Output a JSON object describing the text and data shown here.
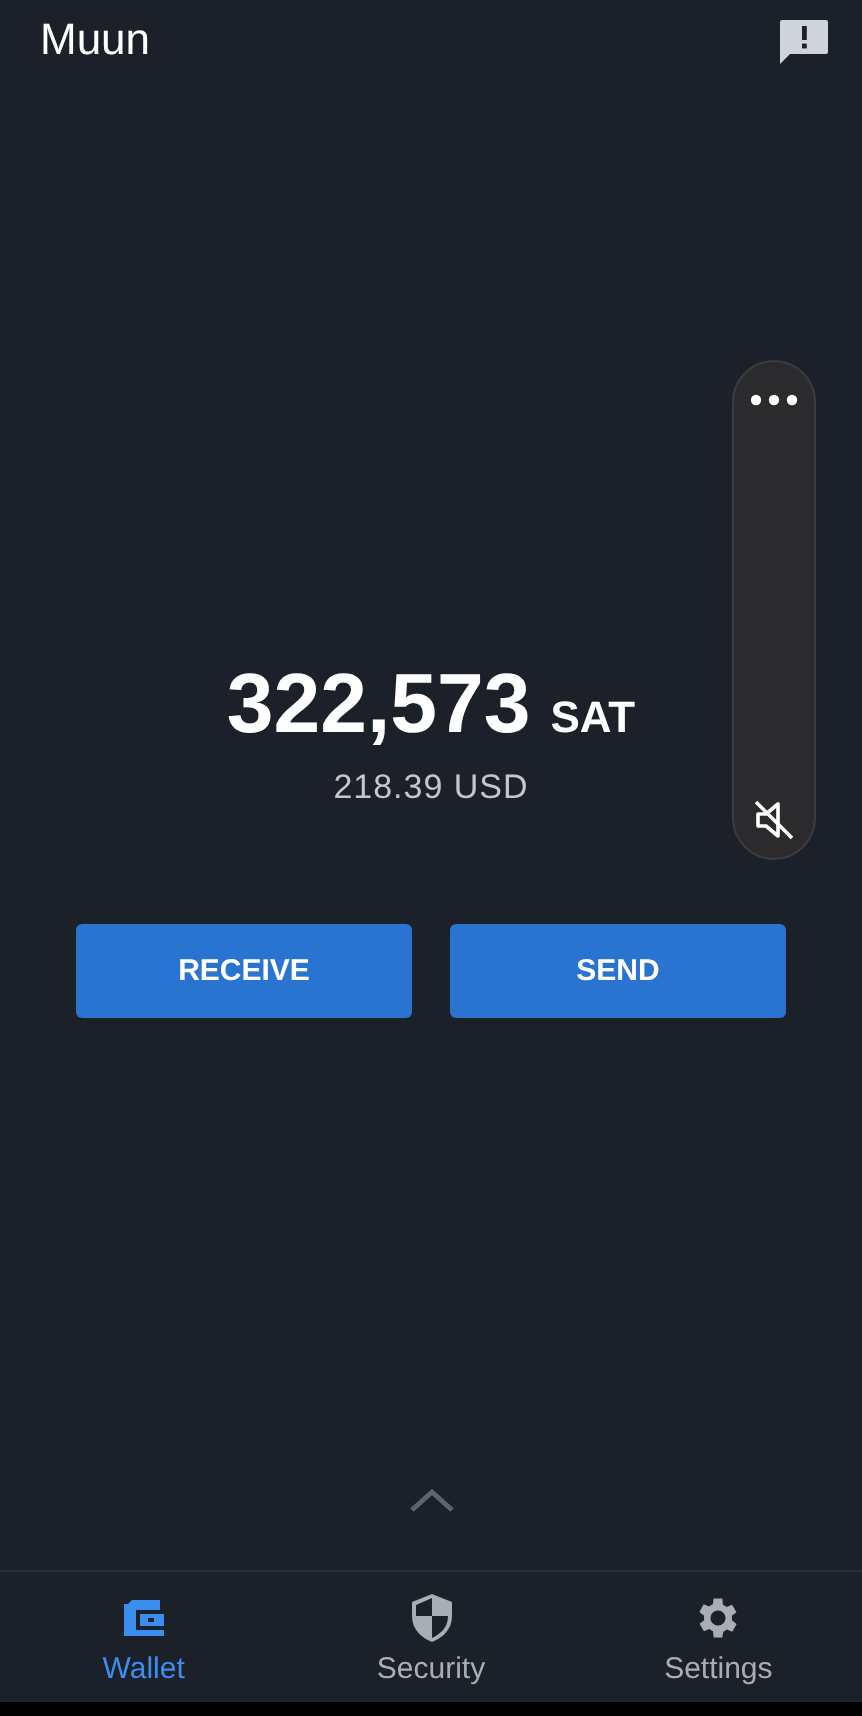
{
  "app_title": "Muun",
  "balance": {
    "amount": "322,573",
    "unit": "SAT",
    "fiat": "218.39 USD"
  },
  "actions": [
    {
      "label": "RECEIVE"
    },
    {
      "label": "SEND"
    }
  ],
  "volume_panel": {
    "muted": true
  },
  "tabs": [
    {
      "label": "Wallet",
      "kind": "wallet",
      "selected": true
    },
    {
      "label": "Security",
      "kind": "security",
      "selected": false
    },
    {
      "label": "Settings",
      "kind": "settings",
      "selected": false
    }
  ]
}
